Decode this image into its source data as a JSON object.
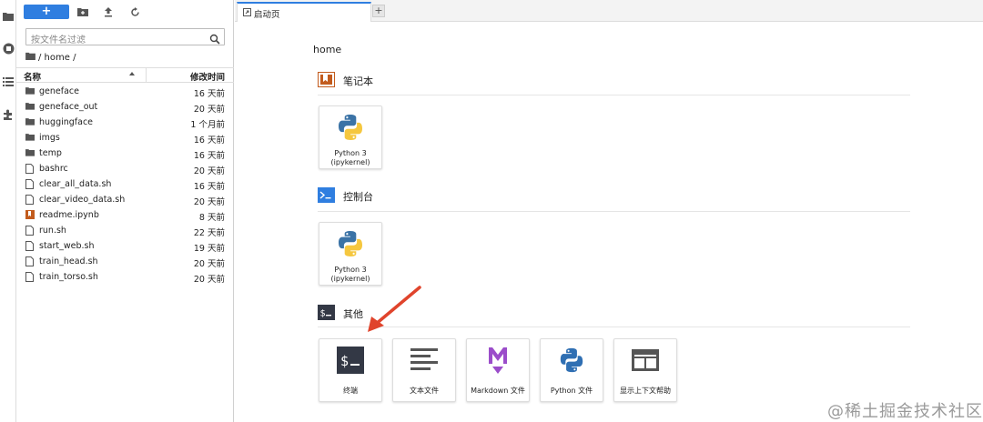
{
  "activity_bar": {
    "icons": [
      "folder-icon",
      "running-icon",
      "toc-icon",
      "extension-icon"
    ]
  },
  "file_browser": {
    "new_button_label": "+",
    "filter_placeholder": "按文件名过滤",
    "breadcrumb": "/ home /",
    "column_name": "名称",
    "column_modified": "修改时间",
    "files": [
      {
        "name": "geneface",
        "time": "16 天前",
        "type": "folder"
      },
      {
        "name": "geneface_out",
        "time": "20 天前",
        "type": "folder"
      },
      {
        "name": "huggingface",
        "time": "1 个月前",
        "type": "folder"
      },
      {
        "name": "imgs",
        "time": "16 天前",
        "type": "folder"
      },
      {
        "name": "temp",
        "time": "16 天前",
        "type": "folder"
      },
      {
        "name": "bashrc",
        "time": "20 天前",
        "type": "file"
      },
      {
        "name": "clear_all_data.sh",
        "time": "16 天前",
        "type": "file"
      },
      {
        "name": "clear_video_data.sh",
        "time": "20 天前",
        "type": "file"
      },
      {
        "name": "readme.ipynb",
        "time": "8 天前",
        "type": "notebook"
      },
      {
        "name": "run.sh",
        "time": "22 天前",
        "type": "file"
      },
      {
        "name": "start_web.sh",
        "time": "19 天前",
        "type": "file"
      },
      {
        "name": "train_head.sh",
        "time": "20 天前",
        "type": "file"
      },
      {
        "name": "train_torso.sh",
        "time": "20 天前",
        "type": "file"
      }
    ]
  },
  "tabs": {
    "active_label": "启动页",
    "add_label": "+"
  },
  "launcher": {
    "cwd": "home",
    "sections": {
      "notebook": {
        "title": "笔记本",
        "cards": [
          {
            "line1": "Python 3",
            "line2": "(ipykernel)"
          }
        ]
      },
      "console": {
        "title": "控制台",
        "cards": [
          {
            "line1": "Python 3",
            "line2": "(ipykernel)"
          }
        ]
      },
      "other": {
        "title": "其他",
        "cards": [
          {
            "label": "终端"
          },
          {
            "label": "文本文件"
          },
          {
            "label": "Markdown 文件"
          },
          {
            "label": "Python 文件"
          },
          {
            "label": "显示上下文帮助"
          }
        ]
      }
    }
  },
  "watermark": "@稀土掘金技术社区",
  "colors": {
    "accent": "#2f7ee0",
    "notebook_orange": "#c25b1d",
    "console_blue": "#2f7ee0",
    "terminal_dark": "#333845",
    "markdown_purple": "#9b4dca",
    "arrow_red": "#e0442c"
  }
}
